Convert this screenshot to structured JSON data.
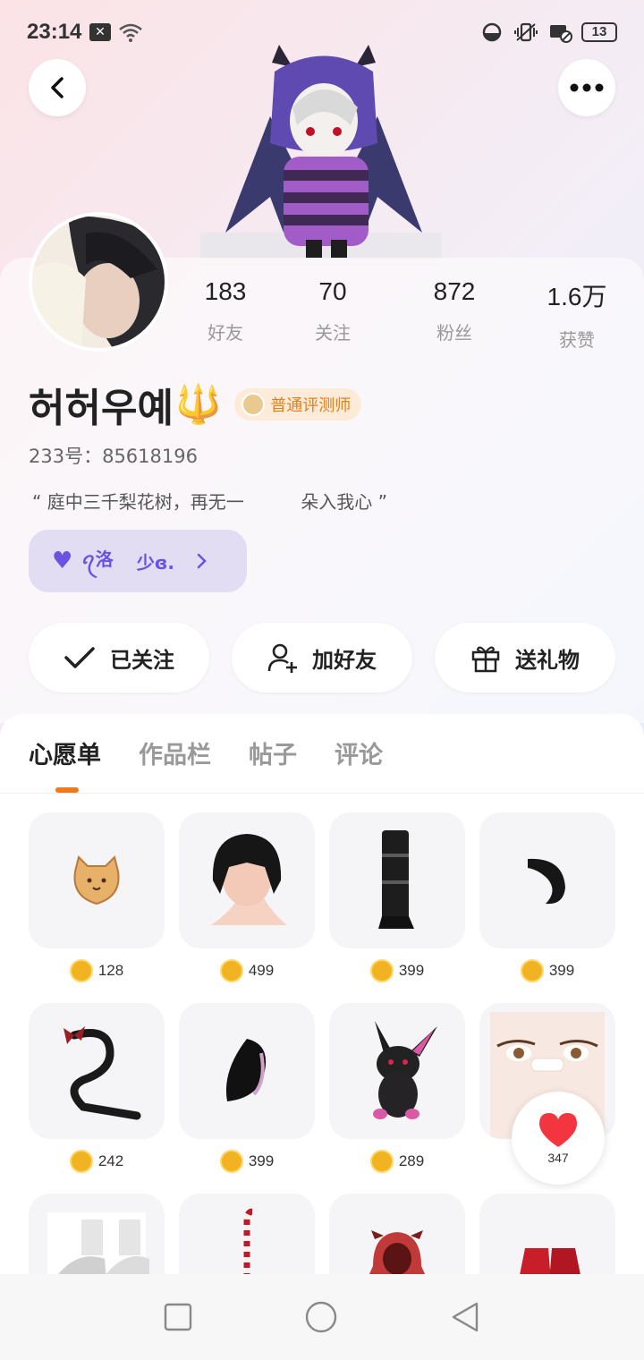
{
  "status_bar": {
    "time": "23:14",
    "battery": "13"
  },
  "profile": {
    "name": "허허우예",
    "badge": "普通评测师",
    "uid": "233号：85618196",
    "motto": "“ 庭中三千梨花树，再无一          朵入我心 ”",
    "cp": {
      "name1": "ꪖ洛",
      "name2": "少ɞ."
    }
  },
  "stats": [
    {
      "value": "183",
      "label": "好友"
    },
    {
      "value": "70",
      "label": "关注"
    },
    {
      "value": "872",
      "label": "粉丝"
    },
    {
      "value": "1.6万",
      "label": "获赞"
    }
  ],
  "actions": {
    "followed": "已关注",
    "add_friend": "加好友",
    "send_gift": "送礼物"
  },
  "tabs": [
    "心愿单",
    "作品栏",
    "帖子",
    "评论"
  ],
  "items": [
    {
      "name": "cat-toast",
      "price": "128"
    },
    {
      "name": "black-hair",
      "price": "499"
    },
    {
      "name": "black-socks",
      "price": "399"
    },
    {
      "name": "black-tail",
      "price": "399"
    },
    {
      "name": "devil-tail",
      "price": "242"
    },
    {
      "name": "black-ear",
      "price": "399"
    },
    {
      "name": "bunny-plush",
      "price": "289"
    },
    {
      "name": "face-bandage",
      "price": ""
    },
    {
      "name": "white-sneakers",
      "price": ""
    },
    {
      "name": "candy-cane",
      "price": ""
    },
    {
      "name": "red-hoodie",
      "price": ""
    },
    {
      "name": "red-shoes",
      "price": ""
    }
  ],
  "like": {
    "count": "347"
  },
  "colors": {
    "accent_orange": "#f07a1a",
    "cp_purple": "#6b52e0",
    "badge_bg": "#fdebd9",
    "coin_gold": "#f2b323"
  }
}
